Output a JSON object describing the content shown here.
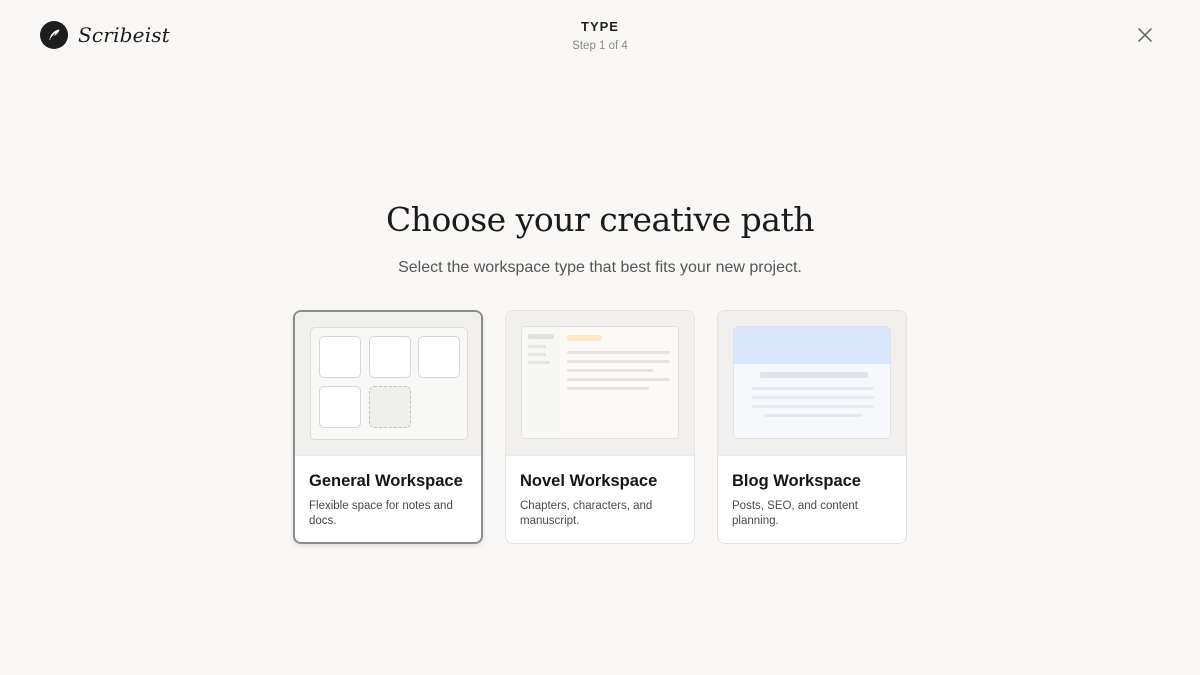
{
  "brand": {
    "name": "Scribeist",
    "logo_icon": "quill-icon"
  },
  "step": {
    "title": "TYPE",
    "subtitle": "Step 1 of 4"
  },
  "close_icon": "close-icon",
  "hero": {
    "title": "Choose your creative path",
    "subtitle": "Select the workspace type that best fits your new project."
  },
  "cards": [
    {
      "title": "General Workspace",
      "description": "Flexible space for notes and docs.",
      "selected": true
    },
    {
      "title": "Novel Workspace",
      "description": "Chapters, characters, and manuscript.",
      "selected": false
    },
    {
      "title": "Blog Workspace",
      "description": "Posts, SEO, and content planning.",
      "selected": false
    }
  ],
  "colors": {
    "background": "#f9f8f6",
    "selected_border": "#8c8c8c",
    "novel_highlight": "#fde9c8",
    "blog_header": "#d9e6fb"
  }
}
